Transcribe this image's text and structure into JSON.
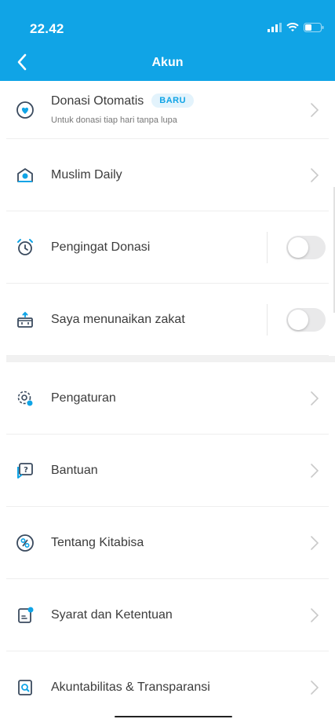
{
  "status_bar": {
    "time": "22.42",
    "icons": [
      "signal-icon",
      "wifi-icon",
      "battery-icon"
    ]
  },
  "header": {
    "title": "Akun",
    "back_icon": "chevron-left-icon",
    "bg_color": "#10a4e6"
  },
  "section1": [
    {
      "icon": "heart-donation-icon",
      "label": "Donasi Otomatis",
      "badge": "BARU",
      "subtitle": "Untuk donasi tiap hari tanpa lupa",
      "control": "chevron"
    },
    {
      "icon": "mosque-icon",
      "label": "Muslim Daily",
      "control": "chevron"
    },
    {
      "icon": "alarm-icon",
      "label": "Pengingat Donasi",
      "control": "toggle",
      "toggle_on": false
    },
    {
      "icon": "zakat-box-icon",
      "label": "Saya menunaikan zakat",
      "control": "toggle",
      "toggle_on": false
    }
  ],
  "section2": [
    {
      "icon": "settings-gear-icon",
      "label": "Pengaturan"
    },
    {
      "icon": "help-bubble-icon",
      "label": "Bantuan"
    },
    {
      "icon": "kitabisa-logo-icon",
      "label": "Tentang Kitabisa"
    },
    {
      "icon": "document-icon",
      "label": "Syarat dan Ketentuan"
    },
    {
      "icon": "search-document-icon",
      "label": "Akuntabilitas & Transparansi"
    }
  ]
}
